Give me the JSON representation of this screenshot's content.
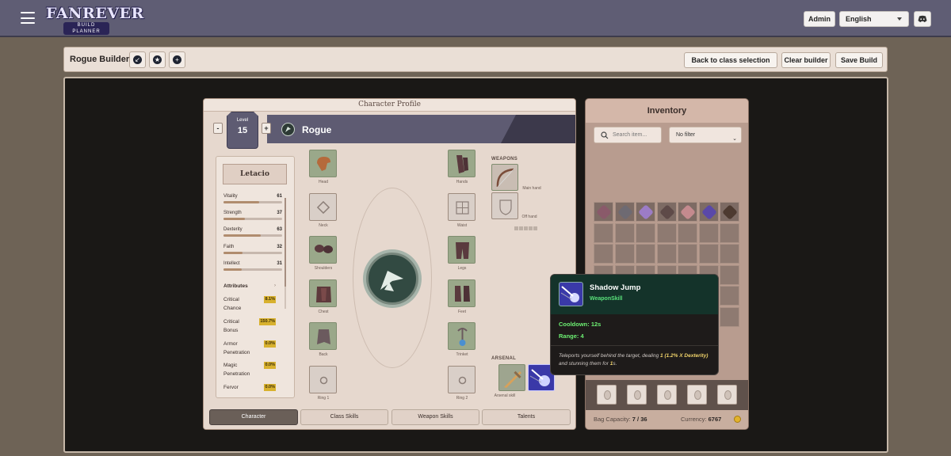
{
  "header": {
    "logo_main": "FANREVER",
    "logo_sub": "BUILD PLANNER",
    "admin_label": "Admin",
    "language": "English"
  },
  "builder": {
    "title": "Rogue Builder",
    "back_label": "Back to class selection",
    "clear_label": "Clear builder",
    "save_label": "Save Build"
  },
  "profile": {
    "panel_title": "Character Profile",
    "level_label": "Level",
    "level": "15",
    "minus": "-",
    "plus": "+",
    "class_name": "Rogue",
    "character_name": "Letacio",
    "stats": [
      {
        "name": "Vitality",
        "value": "61",
        "fill": 0.61
      },
      {
        "name": "Strength",
        "value": "37",
        "fill": 0.37
      },
      {
        "name": "Dexterity",
        "value": "63",
        "fill": 0.63
      },
      {
        "name": "Faith",
        "value": "32",
        "fill": 0.32
      },
      {
        "name": "Intellect",
        "value": "31",
        "fill": 0.31
      }
    ],
    "attributes_heading": "Attributes",
    "attributes": [
      {
        "name": "Critical Chance",
        "value": "8.1%"
      },
      {
        "name": "Critical Bonus",
        "value": "150.7%"
      },
      {
        "name": "Armor Penetration",
        "value": "0.0%"
      },
      {
        "name": "Magic Penetration",
        "value": "0.0%"
      },
      {
        "name": "Fervor",
        "value": "0.0%"
      }
    ],
    "slots": {
      "head": "Head",
      "neck": "Neck",
      "shoulders": "Shoulders",
      "chest": "Chest",
      "back": "Back",
      "ring1": "Ring 1",
      "hands": "Hands",
      "waist": "Waist",
      "legs": "Legs",
      "feet": "Feet",
      "trinket": "Trinket",
      "ring2": "Ring 2"
    },
    "weapons_heading": "WEAPONS",
    "main_hand": "Main hand",
    "off_hand": "Off hand",
    "arsenal_heading": "ARSENAL",
    "arsenal_skill": "Arsenal skill",
    "tabs": [
      "Character",
      "Class Skills",
      "Weapon Skills",
      "Talents"
    ]
  },
  "inventory": {
    "title": "Inventory",
    "search_placeholder": "Search item...",
    "filter": "No filter",
    "bag_capacity_label": "Bag Capacity:",
    "bag_capacity": "7 / 36",
    "currency_label": "Currency:",
    "currency": "6767"
  },
  "tooltip": {
    "name": "Shadow Jump",
    "type": "WeaponSkill",
    "cooldown": "Cooldown: 12s",
    "range": "Range: 4",
    "desc_1": "Teleports yourself behind the target, dealing ",
    "desc_hl_1": "1 (1.2% X Dexterity)",
    "desc_2": " and stunning them for ",
    "desc_hl_2": "1",
    "desc_3": "s."
  },
  "colors": {
    "topbar": "#5f5d74",
    "accent_green": "#59e07a",
    "highlight_gold": "#d8b12e"
  }
}
